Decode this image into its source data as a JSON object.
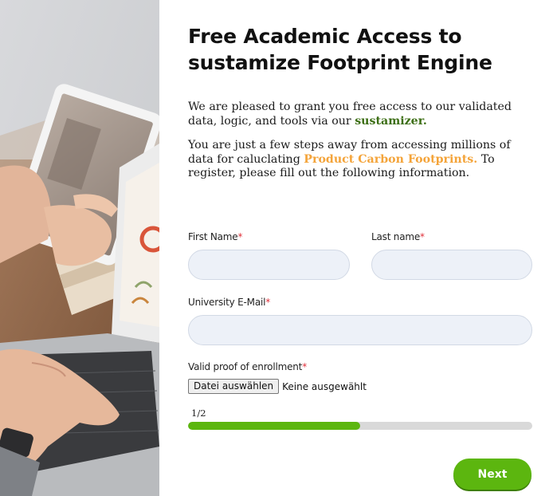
{
  "title": "Free Academic Access to sustamize Footprint Engine",
  "intro": {
    "p1_text": "We are pleased to grant you free access to our validated data, logic, and tools via our ",
    "p1_highlight": "sustamizer.",
    "p2_text_before": "You are just a few steps away from accessing millions of data for caluclating ",
    "p2_highlight": "Product Carbon Footprints.",
    "p2_text_after": " To register, please fill out the following information."
  },
  "form": {
    "first_name_label": "First Name",
    "last_name_label": "Last name",
    "email_label": "University E-Mail",
    "proof_label": "Valid proof of enrollment",
    "required_mark": "*",
    "first_name_value": "",
    "last_name_value": "",
    "email_value": "",
    "file_button": "Datei auswählen",
    "file_status": "Keine ausgewählt"
  },
  "progress": {
    "step_text": "1/2",
    "fraction": 0.5
  },
  "next_label": "Next",
  "colors": {
    "accent_green": "#5cb60f",
    "highlight_green": "#3c6e14",
    "highlight_orange": "#f4a43a",
    "required_red": "#e0303a",
    "input_bg": "#edf1f8"
  }
}
